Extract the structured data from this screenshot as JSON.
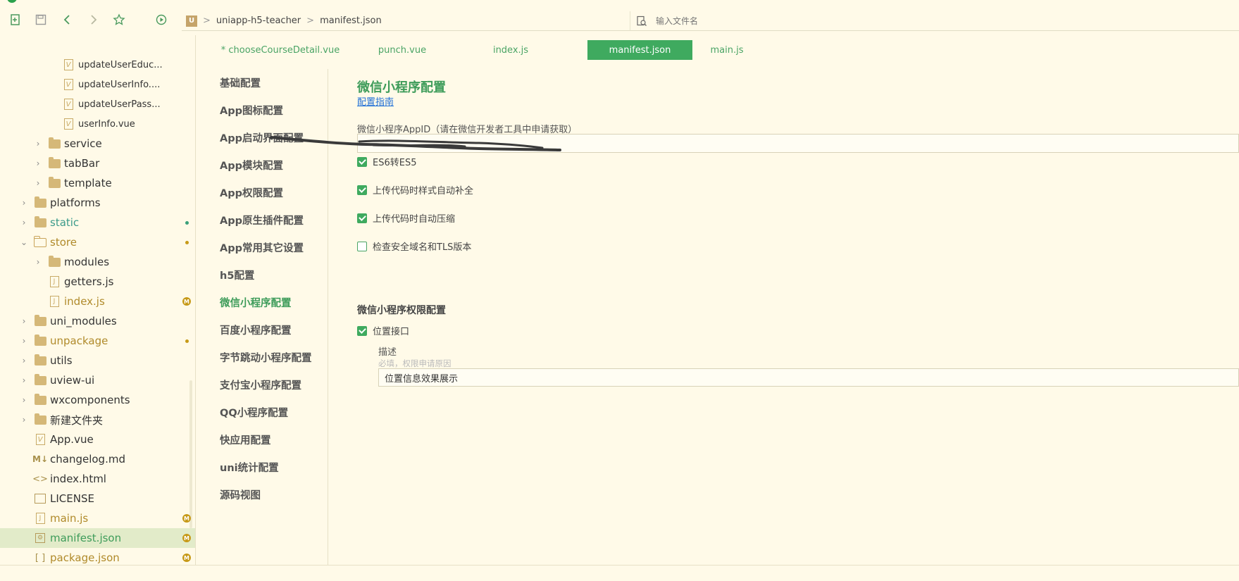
{
  "toolbar": {
    "breadcrumb": {
      "logo": "U",
      "project": "uniapp-h5-teacher",
      "file": "manifest.json"
    },
    "search_placeholder": "输入文件名"
  },
  "file_tree": [
    {
      "label": "updateUserEduc...",
      "type": "vue",
      "depth": 3
    },
    {
      "label": "updateUserInfo....",
      "type": "vue",
      "depth": 3
    },
    {
      "label": "updateUserPass...",
      "type": "vue",
      "depth": 3
    },
    {
      "label": "userInfo.vue",
      "type": "vue",
      "depth": 3
    },
    {
      "label": "service",
      "type": "folder",
      "depth": 2
    },
    {
      "label": "tabBar",
      "type": "folder",
      "depth": 2
    },
    {
      "label": "template",
      "type": "folder",
      "depth": 2
    },
    {
      "label": "platforms",
      "type": "folder",
      "depth": 1
    },
    {
      "label": "static",
      "type": "folder",
      "depth": 1,
      "color": "#3a9a8a",
      "marker": "dot",
      "marker_color": "#3aa07a"
    },
    {
      "label": "store",
      "type": "folder-open",
      "depth": 1,
      "color": "#b08a2a",
      "marker": "dot",
      "marker_color": "#c79a18"
    },
    {
      "label": "modules",
      "type": "folder",
      "depth": 2
    },
    {
      "label": "getters.js",
      "type": "js",
      "depth": 2
    },
    {
      "label": "index.js",
      "type": "js",
      "depth": 2,
      "color": "#b08a2a",
      "marker": "badge",
      "badge": "M"
    },
    {
      "label": "uni_modules",
      "type": "folder",
      "depth": 1
    },
    {
      "label": "unpackage",
      "type": "folder",
      "depth": 1,
      "color": "#b08a2a",
      "marker": "dot",
      "marker_color": "#c79a18"
    },
    {
      "label": "utils",
      "type": "folder",
      "depth": 1
    },
    {
      "label": "uview-ui",
      "type": "folder",
      "depth": 1
    },
    {
      "label": "wxcomponents",
      "type": "folder",
      "depth": 1
    },
    {
      "label": "新建文件夹",
      "type": "folder",
      "depth": 1
    },
    {
      "label": "App.vue",
      "type": "vue",
      "depth": 1
    },
    {
      "label": "changelog.md",
      "type": "md",
      "depth": 1
    },
    {
      "label": "index.html",
      "type": "html",
      "depth": 1
    },
    {
      "label": "LICENSE",
      "type": "license",
      "depth": 1
    },
    {
      "label": "main.js",
      "type": "js",
      "depth": 1,
      "color": "#b08a2a",
      "marker": "badge",
      "badge": "M"
    },
    {
      "label": "manifest.json",
      "type": "json-gear",
      "depth": 1,
      "color": "#b08a2a",
      "marker": "badge",
      "badge": "M",
      "selected": true
    },
    {
      "label": "package.json",
      "type": "brackets",
      "depth": 1,
      "color": "#b08a2a",
      "marker": "badge",
      "badge": "M"
    }
  ],
  "tabs": [
    {
      "label": "* chooseCourseDetail.vue"
    },
    {
      "label": "punch.vue"
    },
    {
      "label": "index.js"
    },
    {
      "label": "manifest.json",
      "active": true
    },
    {
      "label": "main.js"
    }
  ],
  "config_nav": [
    "基础配置",
    "App图标配置",
    "App启动界面配置",
    "App模块配置",
    "App权限配置",
    "App原生插件配置",
    "App常用其它设置",
    "h5配置",
    "微信小程序配置",
    "百度小程序配置",
    "字节跳动小程序配置",
    "支付宝小程序配置",
    "QQ小程序配置",
    "快应用配置",
    "uni统计配置",
    "源码视图"
  ],
  "active_nav": "微信小程序配置",
  "panel": {
    "title": "微信小程序配置",
    "guide_link": "配置指南",
    "appid_label": "微信小程序AppID（请在微信开发者工具中申请获取）",
    "appid_value": "",
    "options": [
      {
        "label": "ES6转ES5",
        "checked": true
      },
      {
        "label": "上传代码时样式自动补全",
        "checked": true
      },
      {
        "label": "上传代码时自动压缩",
        "checked": true
      },
      {
        "label": "检查安全域名和TLS版本",
        "checked": false
      }
    ],
    "permissions_title": "微信小程序权限配置",
    "location_permission": {
      "label": "位置接口",
      "checked": true
    },
    "desc_label": "描述",
    "desc_hint": "必填，权限申请原因",
    "desc_value": "位置信息效果展示"
  },
  "colors": {
    "accent": "#3faa5f",
    "background": "#fffae8",
    "link": "#1f6fd6",
    "modified": "#c79a18"
  }
}
